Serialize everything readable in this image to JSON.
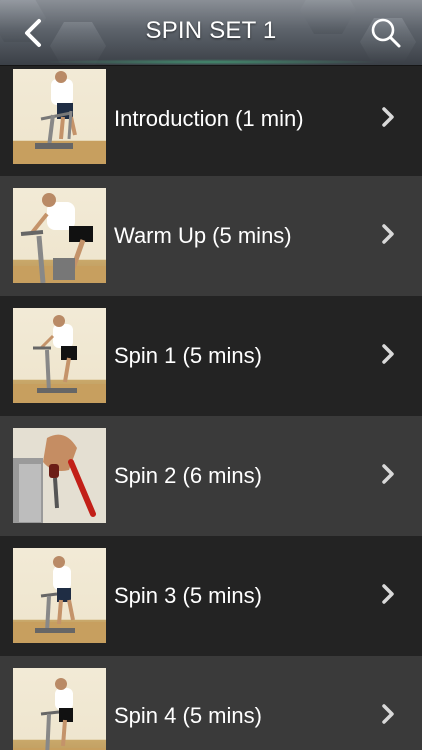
{
  "header": {
    "title": "SPIN SET 1",
    "back_icon": "chevron-left-icon",
    "search_icon": "search-icon"
  },
  "colors": {
    "row_dark": "#232323",
    "row_light": "#3a3a3a",
    "text": "#ffffff",
    "chevron": "#d9d9d9"
  },
  "items": [
    {
      "label": "Introduction (1 min)",
      "icon": "chevron-right-icon"
    },
    {
      "label": "Warm Up (5 mins)",
      "icon": "chevron-right-icon"
    },
    {
      "label": "Spin 1 (5 mins)",
      "icon": "chevron-right-icon"
    },
    {
      "label": "Spin 2 (6 mins)",
      "icon": "chevron-right-icon"
    },
    {
      "label": "Spin 3 (5 mins)",
      "icon": "chevron-right-icon"
    },
    {
      "label": "Spin 4 (5 mins)",
      "icon": "chevron-right-icon"
    }
  ]
}
